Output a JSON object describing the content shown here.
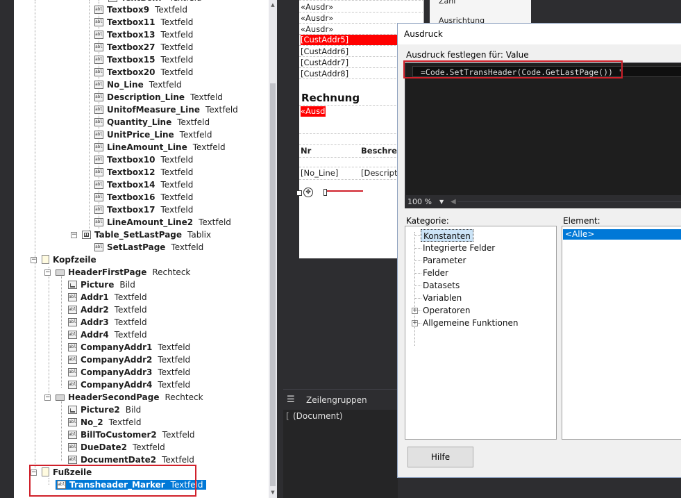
{
  "tree": {
    "rows": [
      {
        "name": "Textbox9",
        "type": "Textfeld"
      },
      {
        "name": "Textbox11",
        "type": "Textfeld"
      },
      {
        "name": "Textbox13",
        "type": "Textfeld"
      },
      {
        "name": "Textbox27",
        "type": "Textfeld"
      },
      {
        "name": "Textbox15",
        "type": "Textfeld"
      },
      {
        "name": "Textbox20",
        "type": "Textfeld"
      },
      {
        "name": "No_Line",
        "type": "Textfeld"
      },
      {
        "name": "Description_Line",
        "type": "Textfeld"
      },
      {
        "name": "UnitofMeasure_Line",
        "type": "Textfeld"
      },
      {
        "name": "Quantity_Line",
        "type": "Textfeld"
      },
      {
        "name": "UnitPrice_Line",
        "type": "Textfeld"
      },
      {
        "name": "LineAmount_Line",
        "type": "Textfeld"
      },
      {
        "name": "Textbox10",
        "type": "Textfeld"
      },
      {
        "name": "Textbox12",
        "type": "Textfeld"
      },
      {
        "name": "Textbox14",
        "type": "Textfeld"
      },
      {
        "name": "Textbox16",
        "type": "Textfeld"
      },
      {
        "name": "Textbox17",
        "type": "Textfeld"
      },
      {
        "name": "LineAmount_Line2",
        "type": "Textfeld"
      },
      {
        "name": "Table_SetLastPage",
        "type": "Tablix"
      },
      {
        "name": "SetLastPage",
        "type": "Textfeld"
      },
      {
        "name": "Kopfzeile",
        "type": ""
      },
      {
        "name": "HeaderFirstPage",
        "type": "Rechteck"
      },
      {
        "name": "Picture",
        "type": "Bild"
      },
      {
        "name": "Addr1",
        "type": "Textfeld"
      },
      {
        "name": "Addr2",
        "type": "Textfeld"
      },
      {
        "name": "Addr3",
        "type": "Textfeld"
      },
      {
        "name": "Addr4",
        "type": "Textfeld"
      },
      {
        "name": "CompanyAddr1",
        "type": "Textfeld"
      },
      {
        "name": "CompanyAddr2",
        "type": "Textfeld"
      },
      {
        "name": "CompanyAddr3",
        "type": "Textfeld"
      },
      {
        "name": "CompanyAddr4",
        "type": "Textfeld"
      },
      {
        "name": "HeaderSecondPage",
        "type": "Rechteck"
      },
      {
        "name": "Picture2",
        "type": "Bild"
      },
      {
        "name": "No_2",
        "type": "Textfeld"
      },
      {
        "name": "BillToCustomer2",
        "type": "Textfeld"
      },
      {
        "name": "DueDate2",
        "type": "Textfeld"
      },
      {
        "name": "DocumentDate2",
        "type": "Textfeld"
      },
      {
        "name": "Fußzeile",
        "type": ""
      },
      {
        "name": "Transheader_Marker",
        "type": "Textfeld"
      }
    ]
  },
  "report": {
    "cells": [
      "«Ausdr»",
      "«Ausdr»",
      "«Ausdr»",
      "[CustAddr5]",
      "[CustAddr6]",
      "[CustAddr7]",
      "[CustAddr8]"
    ],
    "title": "Rechnung",
    "red_cell": "«Ausd",
    "col1_header": "Nr",
    "col2_header": "Beschreib",
    "col1_value": "[No_Line]",
    "col2_value": "[Description"
  },
  "props": {
    "item1": "Zahl",
    "item2": "Ausrichtung"
  },
  "groups": {
    "header": "Zeilengruppen",
    "item": "(Document)"
  },
  "dialog": {
    "title": "Ausdruck",
    "expr_label": "Ausdruck festlegen für: Value",
    "expression": "=Code.SetTransHeader(Code.GetLastPage()) '",
    "zoom": "100 %",
    "category_label": "Kategorie:",
    "categories": [
      "Konstanten",
      "Integrierte Felder",
      "Parameter",
      "Felder",
      "Datasets",
      "Variablen",
      "Operatoren",
      "Allgemeine Funktionen"
    ],
    "element_label": "Element:",
    "element_item": "<Alle>",
    "help_label": "Hilfe"
  },
  "colors": {
    "accent": "#0078d7",
    "highlight": "#d0202a",
    "editor_bg": "#1e1e1e"
  }
}
